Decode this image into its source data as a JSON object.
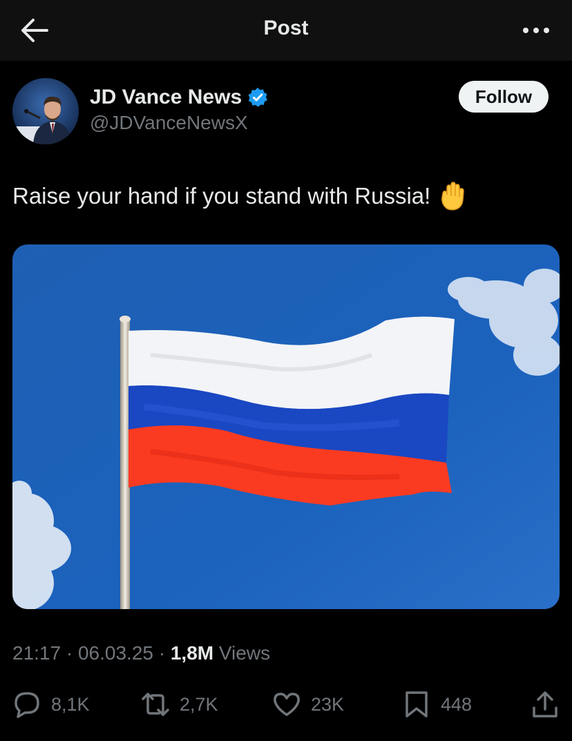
{
  "header": {
    "title": "Post",
    "back_icon": "arrow-left-icon",
    "more_icon": "more-horizontal-icon"
  },
  "author": {
    "name": "JD Vance News",
    "handle": "@JDVanceNewsX",
    "verified": true,
    "follow_label": "Follow"
  },
  "post": {
    "text": "Raise your hand if you stand with Russia!",
    "emoji": "raised-hand-emoji",
    "media": "photo-russian-flag-on-pole-blue-sky"
  },
  "meta": {
    "time": "21:17",
    "date": "06.03.25",
    "views_count": "1,8M",
    "views_label": "Views",
    "separator": "·"
  },
  "actions": {
    "replies": "8,1K",
    "reposts": "2,7K",
    "likes": "23K",
    "bookmarks": "448"
  },
  "colors": {
    "background": "#000000",
    "text": "#e7e9ea",
    "secondary": "#71767b",
    "verified": "#1d9bf0",
    "follow_bg": "#eff3f4"
  }
}
